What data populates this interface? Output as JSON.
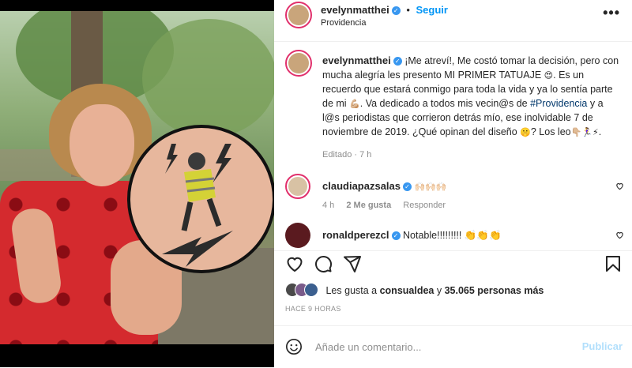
{
  "header": {
    "username": "evelynmatthei",
    "separator": "•",
    "follow_label": "Seguir",
    "location": "Providencia",
    "more_label": "•••"
  },
  "caption": {
    "username": "evelynmatthei",
    "part1": "¡Me atreví!, Me costó tomar la decisión, pero con mucha alegría les presento MI PRIMER TATUAJE ",
    "emoji1": "😍",
    "part2": ". Es un recuerdo que estará conmigo para toda la vida y ya lo sentía parte de mi ",
    "emoji2": "💪🏼",
    "part3": ". Va dedicado a todos mis vecin@s de ",
    "hashtag": "#Providencia",
    "part4": " y a l@s periodistas que corrieron detrás mío, ese inolvidable 7 de noviembre de 2019. ¿Qué opinan del diseño ",
    "emoji3": "🤫",
    "part5": "? Los leo",
    "emoji4": "👇🏼🏃‍♀️⚡",
    "part6": ".",
    "time": "Editado · 7 h"
  },
  "comments": [
    {
      "username": "claudiapazsalas",
      "text": "🙌🏻🙌🏻🙌🏻",
      "time": "4 h",
      "likes": "2 Me gusta",
      "reply": "Responder"
    },
    {
      "username": "ronaldperezcl",
      "text": "Notable!!!!!!!!! 👏👏👏"
    }
  ],
  "likes": {
    "prefix": "Les gusta a ",
    "user": "consualdea",
    "middle": " y ",
    "count": "35.065 personas más"
  },
  "post_time": "HACE 9 HORAS",
  "comment_box": {
    "placeholder": "Añade un comentario...",
    "publish_label": "Publicar"
  },
  "icons": {
    "like": "heart-icon",
    "comment": "comment-icon",
    "share": "share-icon",
    "save": "bookmark-icon",
    "emoji": "emoji-icon"
  },
  "colors": {
    "accent": "#0095f6",
    "verified": "#3897f0",
    "hashtag": "#00376b",
    "publish_disabled": "#b2dffc",
    "dress": "#d42a2e"
  }
}
